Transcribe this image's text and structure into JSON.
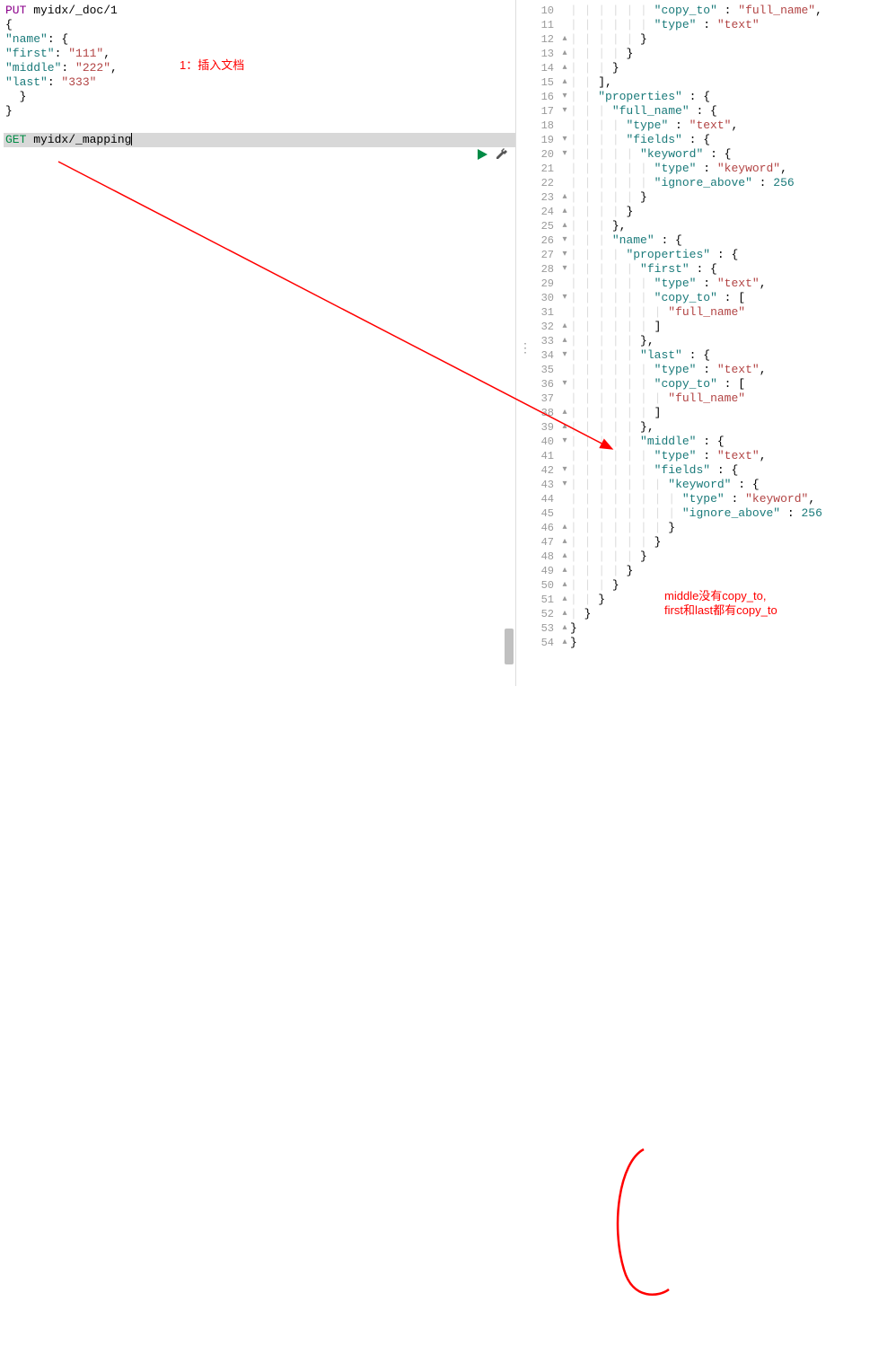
{
  "left_editor": {
    "annotation1": "1：插入文档",
    "lines": [
      {
        "raw": "<span class='kw-put'>PUT</span> myidx/_doc/1"
      },
      {
        "raw": "{"
      },
      {
        "raw": "  <span class='str-key'>\"name\"</span>: {"
      },
      {
        "raw": "    <span class='str-key'>\"first\"</span>: <span class='str-val'>\"111\"</span>,"
      },
      {
        "raw": "    <span class='str-key'>\"middle\"</span>: <span class='str-val'>\"222\"</span>,"
      },
      {
        "raw": "    <span class='str-key'>\"last\"</span>: <span class='str-val'>\"333\"</span>"
      },
      {
        "raw": "  }"
      },
      {
        "raw": "}"
      },
      {
        "raw": ""
      },
      {
        "raw": "<span class='kw-get'>GET</span> myidx/_mapping<span class='cursor-bar'></span>",
        "hl": true
      }
    ]
  },
  "right_editor": {
    "annotation2_line1": "middle没有copy_to,",
    "annotation2_line2": "first和last都有copy_to",
    "lines": [
      {
        "n": 10,
        "f": "",
        "i": 6,
        "raw": "<span class='str-key'>\"copy_to\"</span> : <span class='str-val'>\"full_name\"</span>,"
      },
      {
        "n": 11,
        "f": "",
        "i": 6,
        "raw": "<span class='str-key'>\"type\"</span> : <span class='str-val'>\"text\"</span>"
      },
      {
        "n": 12,
        "f": "▴",
        "i": 5,
        "raw": "}"
      },
      {
        "n": 13,
        "f": "▴",
        "i": 4,
        "raw": "}"
      },
      {
        "n": 14,
        "f": "▴",
        "i": 3,
        "raw": "}"
      },
      {
        "n": 15,
        "f": "▴",
        "i": 2,
        "raw": "],"
      },
      {
        "n": 16,
        "f": "▾",
        "i": 2,
        "raw": "<span class='str-key'>\"properties\"</span> : {"
      },
      {
        "n": 17,
        "f": "▾",
        "i": 3,
        "raw": "<span class='str-key'>\"full_name\"</span> : {"
      },
      {
        "n": 18,
        "f": "",
        "i": 4,
        "raw": "<span class='str-key'>\"type\"</span> : <span class='str-val'>\"text\"</span>,"
      },
      {
        "n": 19,
        "f": "▾",
        "i": 4,
        "raw": "<span class='str-key'>\"fields\"</span> : {"
      },
      {
        "n": 20,
        "f": "▾",
        "i": 5,
        "raw": "<span class='str-key'>\"keyword\"</span> : {"
      },
      {
        "n": 21,
        "f": "",
        "i": 6,
        "raw": "<span class='str-key'>\"type\"</span> : <span class='str-val'>\"keyword\"</span>,"
      },
      {
        "n": 22,
        "f": "",
        "i": 6,
        "raw": "<span class='str-key'>\"ignore_above\"</span> : <span class='num'>256</span>"
      },
      {
        "n": 23,
        "f": "▴",
        "i": 5,
        "raw": "}"
      },
      {
        "n": 24,
        "f": "▴",
        "i": 4,
        "raw": "}"
      },
      {
        "n": 25,
        "f": "▴",
        "i": 3,
        "raw": "},"
      },
      {
        "n": 26,
        "f": "▾",
        "i": 3,
        "raw": "<span class='str-key'>\"name\"</span> : {"
      },
      {
        "n": 27,
        "f": "▾",
        "i": 4,
        "raw": "<span class='str-key'>\"properties\"</span> : {"
      },
      {
        "n": 28,
        "f": "▾",
        "i": 5,
        "raw": "<span class='str-key'>\"first\"</span> : {"
      },
      {
        "n": 29,
        "f": "",
        "i": 6,
        "raw": "<span class='str-key'>\"type\"</span> : <span class='str-val'>\"text\"</span>,"
      },
      {
        "n": 30,
        "f": "▾",
        "i": 6,
        "raw": "<span class='str-key'>\"copy_to\"</span> : ["
      },
      {
        "n": 31,
        "f": "",
        "i": 7,
        "raw": "<span class='str-val'>\"full_name\"</span>"
      },
      {
        "n": 32,
        "f": "▴",
        "i": 6,
        "raw": "]"
      },
      {
        "n": 33,
        "f": "▴",
        "i": 5,
        "raw": "},"
      },
      {
        "n": 34,
        "f": "▾",
        "i": 5,
        "raw": "<span class='str-key'>\"last\"</span> : {"
      },
      {
        "n": 35,
        "f": "",
        "i": 6,
        "raw": "<span class='str-key'>\"type\"</span> : <span class='str-val'>\"text\"</span>,"
      },
      {
        "n": 36,
        "f": "▾",
        "i": 6,
        "raw": "<span class='str-key'>\"copy_to\"</span> : ["
      },
      {
        "n": 37,
        "f": "",
        "i": 7,
        "raw": "<span class='str-val'>\"full_name\"</span>"
      },
      {
        "n": 38,
        "f": "▴",
        "i": 6,
        "raw": "]"
      },
      {
        "n": 39,
        "f": "▴",
        "i": 5,
        "raw": "},"
      },
      {
        "n": 40,
        "f": "▾",
        "i": 5,
        "raw": "<span class='str-key'>\"middle\"</span> : {"
      },
      {
        "n": 41,
        "f": "",
        "i": 6,
        "raw": "<span class='str-key'>\"type\"</span> : <span class='str-val'>\"text\"</span>,"
      },
      {
        "n": 42,
        "f": "▾",
        "i": 6,
        "raw": "<span class='str-key'>\"fields\"</span> : {"
      },
      {
        "n": 43,
        "f": "▾",
        "i": 7,
        "raw": "<span class='str-key'>\"keyword\"</span> : {"
      },
      {
        "n": 44,
        "f": "",
        "i": 8,
        "raw": "<span class='str-key'>\"type\"</span> : <span class='str-val'>\"keyword\"</span>,"
      },
      {
        "n": 45,
        "f": "",
        "i": 8,
        "raw": "<span class='str-key'>\"ignore_above\"</span> : <span class='num'>256</span>"
      },
      {
        "n": 46,
        "f": "▴",
        "i": 7,
        "raw": "}"
      },
      {
        "n": 47,
        "f": "▴",
        "i": 6,
        "raw": "}"
      },
      {
        "n": 48,
        "f": "▴",
        "i": 5,
        "raw": "}"
      },
      {
        "n": 49,
        "f": "▴",
        "i": 4,
        "raw": "}"
      },
      {
        "n": 50,
        "f": "▴",
        "i": 3,
        "raw": "}"
      },
      {
        "n": 51,
        "f": "▴",
        "i": 2,
        "raw": "}"
      },
      {
        "n": 52,
        "f": "▴",
        "i": 1,
        "raw": "}"
      },
      {
        "n": 53,
        "f": "▴",
        "i": 0,
        "raw": "}"
      },
      {
        "n": 54,
        "f": "▴",
        "i": 0,
        "raw": "}"
      }
    ]
  }
}
